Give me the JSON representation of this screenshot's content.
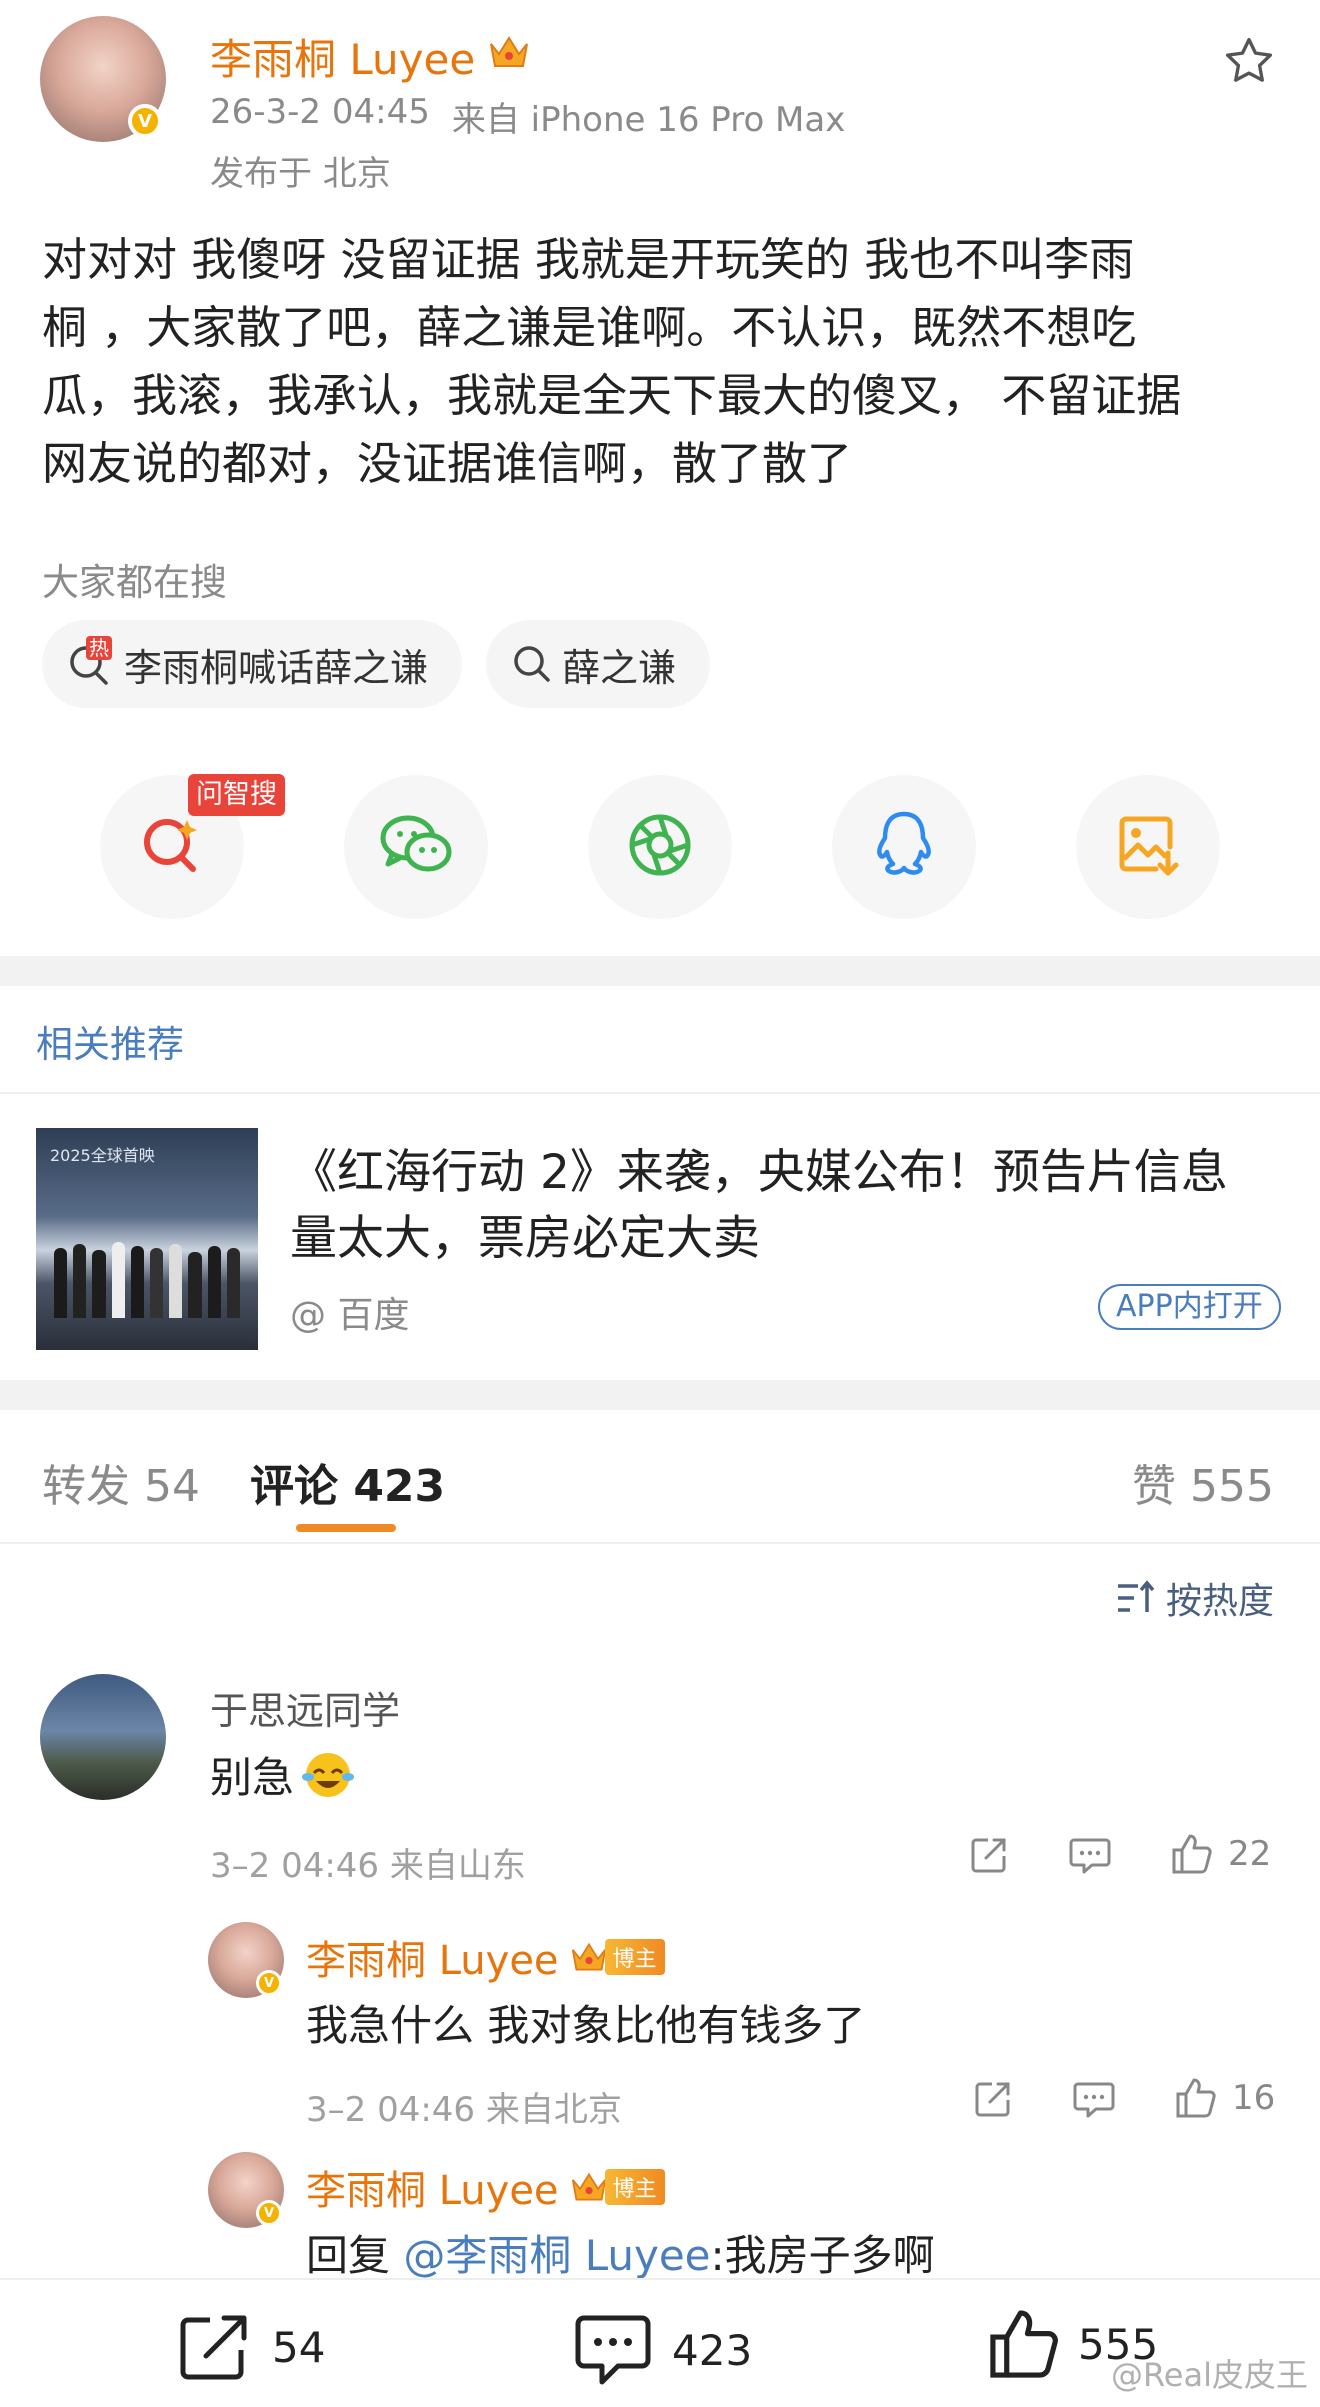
{
  "post": {
    "author": "李雨桐 Luyee",
    "time": "26-3-2 04:45",
    "source": "来自 iPhone 16 Pro Max",
    "location": "发布于 北京",
    "text_lines": [
      "对对对 我傻呀 没留证据 我就是开玩笑的 我也不叫李雨",
      "桐 ，大家散了吧，薛之谦是谁啊。不认识，既然不想吃",
      "瓜，我滚，我承认，我就是全天下最大的傻叉，  不留证据",
      "网友说的都对，没证据谁信啊，散了散了"
    ]
  },
  "search": {
    "heading": "大家都在搜",
    "hot_badge": "热",
    "tags": [
      "李雨桐喊话薛之谦",
      "薛之谦"
    ]
  },
  "share": {
    "ai_badge": "问智搜",
    "icons": [
      "ai-search-icon",
      "wechat-icon",
      "moments-icon",
      "qq-icon",
      "save-image-icon"
    ]
  },
  "related": {
    "heading": "相关推荐",
    "title_line1": "《红海行动 2》来袭，央媒公布！预告片信息",
    "title_line2": "量太大，票房必定大卖",
    "source": "@ 百度",
    "app_button": "APP内打开",
    "thumb_text": "2025全球首映"
  },
  "tabs": {
    "repost": "转发 54",
    "comments": "评论 423",
    "likes": "赞 555"
  },
  "sort": {
    "label": "按热度"
  },
  "comments": [
    {
      "user": "于思远同学",
      "text": "别急",
      "meta": "3–2 04:46 来自山东",
      "likes": "22"
    }
  ],
  "replies": [
    {
      "user": "李雨桐 Luyee",
      "badge": "博主",
      "text": "我急什么 我对象比他有钱多了",
      "meta": "3–2 04:46 来自北京",
      "likes": "16"
    },
    {
      "user": "李雨桐 Luyee",
      "badge": "博主",
      "reply_prefix": "回复 ",
      "mention": "@李雨桐 Luyee",
      "text": ":我房子多啊"
    }
  ],
  "bottom_bar": {
    "repost_count": "54",
    "comment_count": "423",
    "like_count": "555",
    "watermark": "@Real皮皮王"
  },
  "colors": {
    "accent_orange": "#e8740c",
    "link_blue": "#4a7dbd",
    "hot_red": "#e8443a"
  }
}
